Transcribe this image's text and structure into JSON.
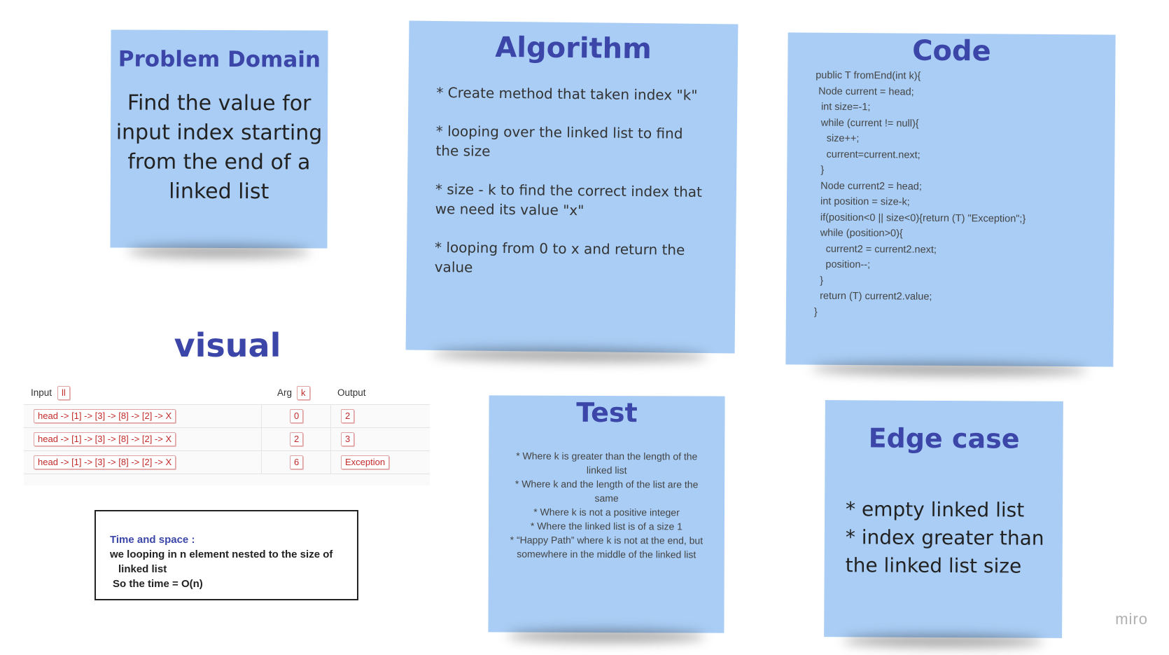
{
  "problem": {
    "title": "Problem Domain",
    "body": "Find the value for input index starting from the end of a linked list"
  },
  "algorithm": {
    "title": "Algorithm",
    "steps": [
      "* Create method that taken index \"k\"",
      "* looping over the linked list to find the size",
      "* size - k to find the correct index that we need its value \"x\"",
      "* looping from 0  to x and return the value"
    ]
  },
  "code": {
    "title": "Code",
    "text": "public T fromEnd(int k){\n Node current = head;\n  int size=-1;\n  while (current != null){\n    size++;\n    current=current.next;\n  }\n  Node current2 = head;\n  int position = size-k;\n  if(position<0 || size<0){return (T) \"Exception\";}\n  while (position>0){\n    current2 = current2.next;\n    position--;\n  }\n  return (T) current2.value;\n}"
  },
  "visual": {
    "title": "visual",
    "headers": {
      "input": "Input",
      "input_tag": "ll",
      "arg": "Arg",
      "arg_tag": "k",
      "output": "Output"
    },
    "rows": [
      {
        "input": "head -> [1] -> [3] -> [8] -> [2] -> X",
        "arg": "0",
        "output": "2"
      },
      {
        "input": "head -> [1] -> [3] -> [8] -> [2] -> X",
        "arg": "2",
        "output": "3"
      },
      {
        "input": "head -> [1] -> [3] -> [8] -> [2] -> X",
        "arg": "6",
        "output": "Exception"
      }
    ]
  },
  "time_space": {
    "title": "Time and space :",
    "line1": "we looping in n element nested to the size of",
    "line2": "linked list",
    "line3": "So the time = O(n)"
  },
  "test": {
    "title": "Test",
    "cases": [
      "* Where k is greater than the length of the linked list",
      "* Where k and the length of the list are the same",
      "* Where k is not a positive integer",
      "* Where the linked list is of a size 1",
      "* “Happy Path” where k is not at the end, but somewhere in the middle of the linked list"
    ]
  },
  "edge": {
    "title": "Edge case",
    "items": [
      "* empty linked list",
      "* index greater than the linked list size"
    ]
  },
  "brand": "miro",
  "colors": {
    "note": "#a9cdf5",
    "title": "#3b46a8",
    "tag": "#c32a2a"
  }
}
